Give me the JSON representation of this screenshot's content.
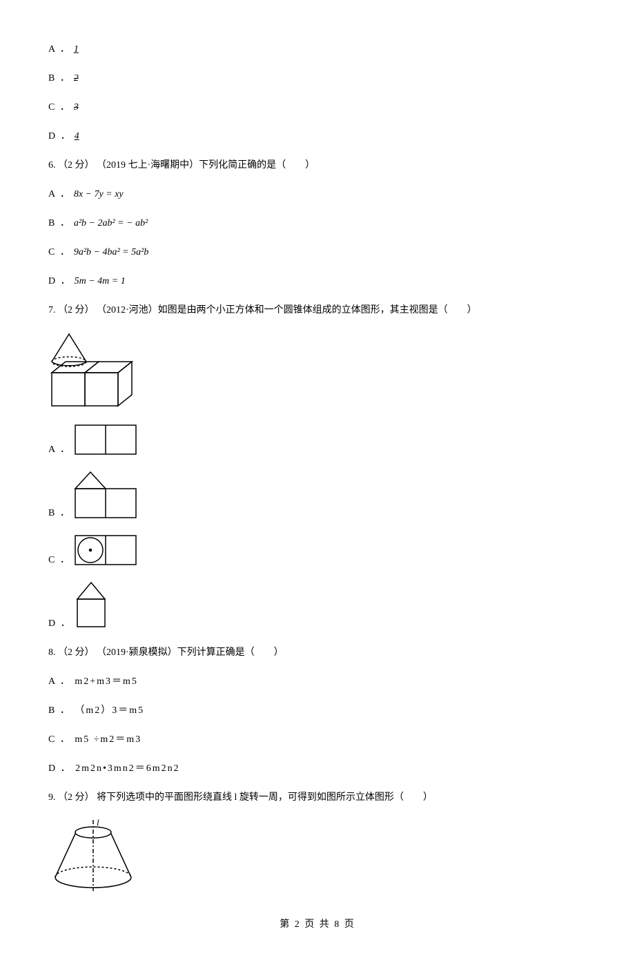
{
  "q5": {
    "a": "A ．",
    "av": "1",
    "b": "B ．",
    "bv": "2",
    "c": "C ．",
    "cv": "3",
    "d": "D ．",
    "dv": "4"
  },
  "q6": {
    "stem_num": "6.  （2 分） （2019 七上·海曙期中）",
    "stem_body": "下列化简正确的是（　　）",
    "a": "A ．",
    "a_math": "8x − 7y = xy",
    "b": "B ．",
    "b_math": "a²b − 2ab² = − ab²",
    "c": "C ．",
    "c_math": "9a²b − 4ba² = 5a²b",
    "d": "D ．",
    "d_math": "5m − 4m = 1"
  },
  "q7": {
    "stem_num": "7.  （2 分） （2012·河池）",
    "stem_body": "如图是由两个小正方体和一个圆锥体组成的立体图形，其主视图是（　　）",
    "a": "A ．",
    "b": "B ．",
    "c": "C ．",
    "d": "D ．"
  },
  "q8": {
    "stem_num": "8.  （2 分） （2019·颍泉模拟）",
    "stem_body": "下列计算正确是（　　）",
    "a": "A ． m2+m3＝m5",
    "b": "B ． （m2）3＝m5",
    "c": "C ． m5 ÷m2＝m3",
    "d": "D ． 2m2n•3mn2＝6m2n2"
  },
  "q9": {
    "stem_num": "9.  （2 分）  将下列选项中的平面图形绕直线 l 旋转一周，可得到如图所示立体图形（　　）"
  },
  "footer": "第 2 页 共 8 页"
}
